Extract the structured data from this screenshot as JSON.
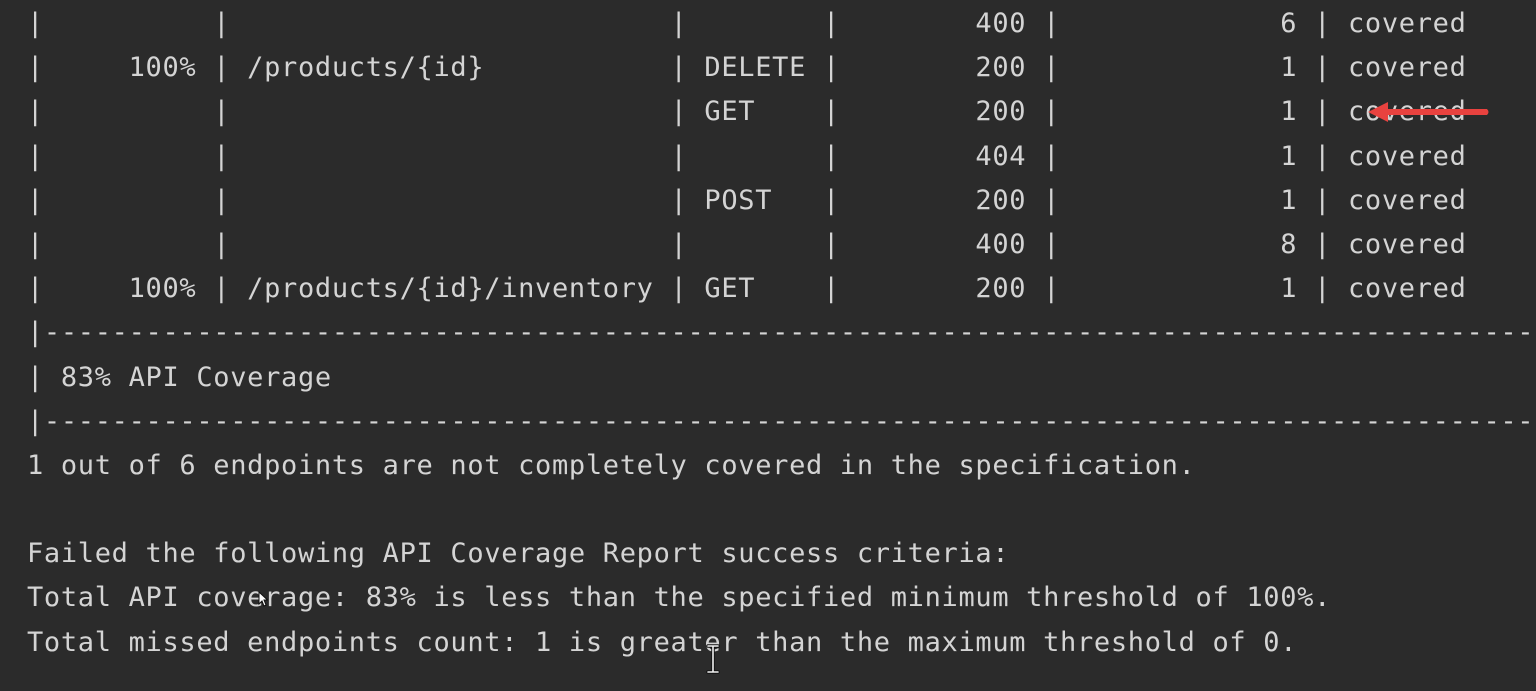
{
  "terminal": {
    "background": "#2b2b2b",
    "text_color": "#d4d4d4",
    "annotation_color": "#e8423f",
    "lines": [
      "|          |                          |        |        400 |             6 | covered            |",
      "|     100% | /products/{id}           | DELETE |        200 |             1 | covered            |",
      "|          |                          | GET    |        200 |             1 | covered            |",
      "|          |                          |        |        404 |             1 | covered            |",
      "|          |                          | POST   |        200 |             1 | covered            |",
      "|          |                          |        |        400 |             8 | covered            |",
      "|     100% | /products/{id}/inventory | GET    |        200 |             1 | covered            |",
      "|---------------------------------------------------------------------------------------------|",
      "| 83% API Coverage                                                                           |",
      "|---------------------------------------------------------------------------------------------|",
      "1 out of 6 endpoints are not completely covered in the specification.",
      "",
      "Failed the following API Coverage Report success criteria:",
      "Total API coverage: 83% is less than the specified minimum threshold of 100%.",
      "Total missed endpoints count: 1 is greater than the maximum threshold of 0."
    ]
  },
  "icons": {
    "annotation": "red-arrow-left-icon",
    "text_cursor": "i-beam-cursor-icon",
    "pointer": "mouse-pointer-icon"
  }
}
